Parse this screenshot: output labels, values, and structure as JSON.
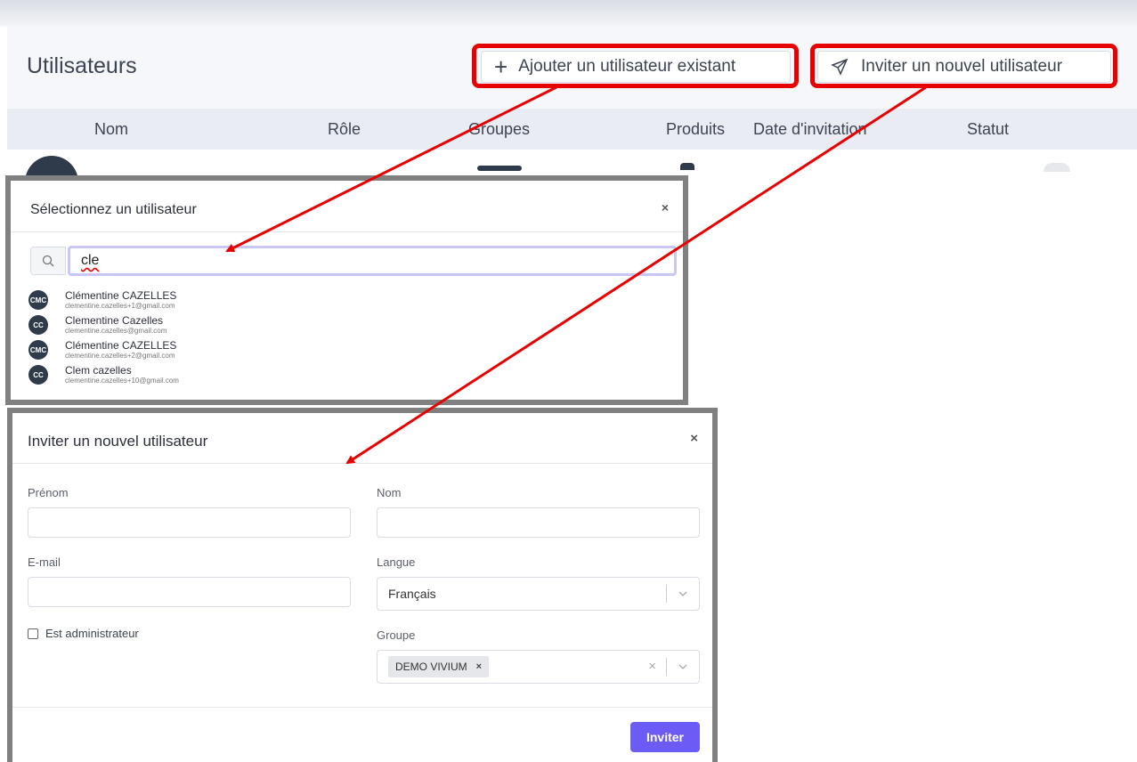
{
  "page": {
    "title": "Utilisateurs",
    "add_existing_label": "Ajouter un utilisateur existant",
    "invite_new_label": "Inviter un nouvel utilisateur",
    "columns": [
      "Nom",
      "Rôle",
      "Groupes",
      "Produits",
      "Date d'invitation",
      "Statut"
    ]
  },
  "select_modal": {
    "title": "Sélectionnez un utilisateur",
    "close": "×",
    "search_value": "cle",
    "users": [
      {
        "initials": "CMC",
        "name": "Clémentine CAZELLES",
        "email": "clementine.cazelles+1@gmail.com"
      },
      {
        "initials": "CC",
        "name": "Clementine Cazelles",
        "email": "clementine.cazelles@gmail.com"
      },
      {
        "initials": "CMC",
        "name": "Clémentine CAZELLES",
        "email": "clementine.cazelles+2@gmail.com"
      },
      {
        "initials": "CC",
        "name": "Clem cazelles",
        "email": "clementine.cazelles+10@gmail.com"
      }
    ]
  },
  "invite_modal": {
    "title": "Inviter un nouvel utilisateur",
    "close": "×",
    "firstname_label": "Prénom",
    "firstname_value": "",
    "lastname_label": "Nom",
    "lastname_value": "",
    "email_label": "E-mail",
    "email_value": "",
    "language_label": "Langue",
    "language_value": "Français",
    "admin_label": "Est administrateur",
    "group_label": "Groupe",
    "group_chip": "DEMO VIVIUM",
    "submit_label": "Inviter"
  },
  "colors": {
    "annotation_red": "#e60000",
    "primary_button": "#6c5cf6",
    "avatar_bg": "#2f3a4b"
  }
}
